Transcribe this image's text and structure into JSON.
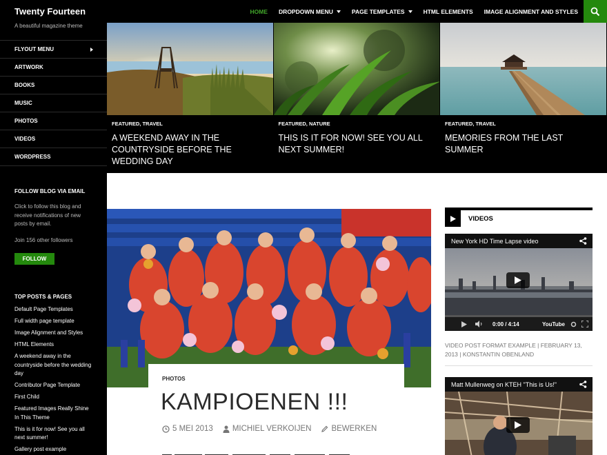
{
  "site": {
    "title": "Twenty Fourteen",
    "tagline": "A beautiful magazine theme"
  },
  "nav": {
    "items": [
      {
        "label": "HOME",
        "active": true,
        "dropdown": false
      },
      {
        "label": "DROPDOWN MENU",
        "active": false,
        "dropdown": true
      },
      {
        "label": "PAGE TEMPLATES",
        "active": false,
        "dropdown": true
      },
      {
        "label": "HTML ELEMENTS",
        "active": false,
        "dropdown": false
      },
      {
        "label": "IMAGE ALIGNMENT AND STYLES",
        "active": false,
        "dropdown": false
      }
    ],
    "search_icon": "search-icon",
    "accent": "#41a62a",
    "search_bg": "#24890d"
  },
  "sidebar": {
    "menu": [
      "FLYOUT MENU",
      "ARTWORK",
      "BOOKS",
      "MUSIC",
      "PHOTOS",
      "VIDEOS",
      "WORDPRESS"
    ],
    "follow": {
      "title": "FOLLOW BLOG VIA EMAIL",
      "text": "Click to follow this blog and receive notifications of new posts by email.",
      "followers": "Join 156 other followers",
      "button": "FOLLOW"
    },
    "top_posts": {
      "title": "TOP POSTS & PAGES",
      "items": [
        "Default Page Templates",
        "Full width page template",
        "Image Alignment and Styles",
        "HTML Elements",
        "A weekend away in the countryside before the wedding day",
        "Contributor Page Template",
        "First Child",
        "Featured Images Really Shine In This Theme",
        "This is it for now! See you all next summer!",
        "Gallery post example"
      ]
    }
  },
  "featured": [
    {
      "meta": "FEATURED, TRAVEL",
      "title": "A WEEKEND AWAY IN THE COUNTRYSIDE BEFORE THE WEDDING DAY"
    },
    {
      "meta": "FEATURED, NATURE",
      "title": "THIS IS IT FOR NOW! SEE YOU ALL NEXT SUMMER!"
    },
    {
      "meta": "FEATURED, TRAVEL",
      "title": "MEMORIES FROM THE LAST SUMMER"
    }
  ],
  "post": {
    "category": "PHOTOS",
    "title": "KAMPIOENEN !!!",
    "date": "5 MEI 2013",
    "author": "MICHIEL VERKOIJEN",
    "edit": "BEWERKEN"
  },
  "videos_widget": {
    "title": "VIDEOS",
    "video1": {
      "title": "New York HD Time Lapse video",
      "time": "0:00 / 4:14",
      "brand": "YouTube"
    },
    "caption": "VIDEO POST FORMAT EXAMPLE | FEBRUARY 13, 2013 | KONSTANTIN OBENLAND",
    "video2": {
      "title": "Matt Mullenweg on KTEH \"This is Us!\""
    }
  }
}
